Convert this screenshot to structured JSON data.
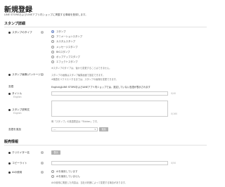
{
  "page": {
    "title": "新規登録",
    "subtitle": "LINE STOREおよびLINEアプリ内ショップに掲載する情報を登録します。"
  },
  "sticker_details": {
    "heading": "スタンプ詳細",
    "type": {
      "label": "スタンプのタイプ",
      "options": [
        {
          "label": "スタンプ",
          "selected": true
        },
        {
          "label": "アニメーションスタンプ",
          "selected": false
        },
        {
          "label": "カスタムスタンプ",
          "selected": false
        },
        {
          "label": "メッセージスタンプ",
          "selected": false
        },
        {
          "label": "BIGスタンプ",
          "selected": false
        },
        {
          "label": "ポップアップスタンプ",
          "selected": false
        },
        {
          "label": "エフェクトスタンプ",
          "selected": false
        }
      ],
      "note": "※スタンプのタイプは、後から変更することはできません。"
    },
    "package": {
      "label": "スタンプ画像(パッケージ)",
      "note1": "スタンプの画像はスタンプ編集画面で設定できます。",
      "note2": "※審査をリクエストするまでは、スタンプの画像を変更できます。"
    },
    "language": {
      "label": "言語",
      "note": "EnglishはLINE STOREおよびLINEアプリ内ショップでは、設定していない言語が表示されます"
    },
    "title_field": {
      "label": "タイトル",
      "sublabel": "English",
      "counter": "0/40"
    },
    "description": {
      "label": "スタンプ説明文",
      "sublabel": "English",
      "counter": "0/160",
      "note": "例「スタンプ」の英語表記は「Sticker」です。"
    },
    "add_language": {
      "label": "言語を追加",
      "select_value": "---",
      "button": "追加"
    }
  },
  "sales_info": {
    "heading": "販売情報",
    "creator": {
      "label": "クリエイター名",
      "button": "表示"
    },
    "copyright": {
      "label": "コピーライト",
      "counter": "0/50"
    },
    "ai_usage": {
      "label": "AIの使用",
      "options": [
        {
          "label": "AIを使用しています",
          "selected": false
        },
        {
          "label": "AIを使用していません",
          "selected": false
        }
      ],
      "note": "AIの使用に関連した内容は、当社の判断によって変更する場合があります。"
    }
  }
}
